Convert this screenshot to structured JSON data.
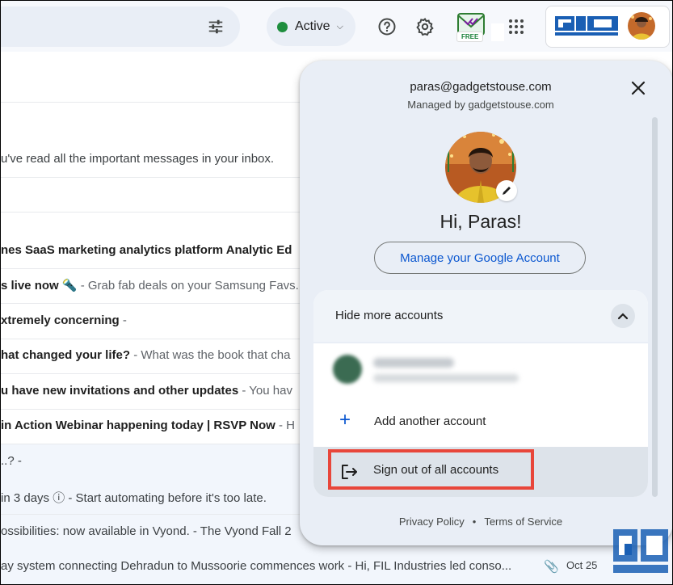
{
  "status": {
    "label": "Active"
  },
  "extension": {
    "badge": "FREE"
  },
  "emails": [
    {
      "subject": "",
      "snippet": "",
      "plain": "u've read all the important messages in your inbox.",
      "date": ""
    },
    {
      "subject": "nes SaaS marketing analytics platform Analytic Ed",
      "snippet": "",
      "plain": "",
      "date": ""
    },
    {
      "subject": "s live now 🔦",
      "snippet": " - Grab fab deals on your Samsung Favs.",
      "plain": "",
      "date": ""
    },
    {
      "subject": "xtremely concerning",
      "snippet": " -",
      "plain": "",
      "date": ""
    },
    {
      "subject": "hat changed your life?",
      "snippet": " - What was the book that cha",
      "plain": "",
      "date": ""
    },
    {
      "subject": "u have new invitations and other updates",
      "snippet": " - You hav",
      "plain": "",
      "date": ""
    },
    {
      "subject": "in Action Webinar happening today | RSVP Now",
      "snippet": " - H",
      "plain": "",
      "date": ""
    },
    {
      "subject": "",
      "snippet": "",
      "plain": "..? -",
      "date": ""
    },
    {
      "subject": "",
      "snippet": "",
      "plain": "in 3 days ⓘ - Start automating before it's too late.",
      "date": ""
    },
    {
      "subject": "",
      "snippet": "",
      "plain": "ossibilities: now available in Vyond. - The Vyond Fall 2",
      "date": ""
    },
    {
      "subject": "",
      "snippet": "",
      "plain": "ay system connecting Dehradun to Mussoorie commences work - Hi, FIL Industries led conso...",
      "date": "Oct 25"
    }
  ],
  "account_menu": {
    "email": "paras@gadgetstouse.com",
    "managed_by": "Managed by gadgetstouse.com",
    "greeting": "Hi, Paras!",
    "manage_button": "Manage your Google Account",
    "hide_accounts": "Hide more accounts",
    "add_account": "Add another account",
    "sign_out": "Sign out of all accounts",
    "privacy": "Privacy Policy",
    "terms": "Terms of Service",
    "separator": "•"
  },
  "colors": {
    "accent_blue": "#0b57d0",
    "status_green": "#1e8e3e",
    "highlight_red": "#e8463a",
    "popup_bg": "#e9eef6"
  },
  "icons": [
    "filter-icon",
    "help-icon",
    "settings-icon",
    "apps-grid-icon",
    "close-icon",
    "edit-pencil-icon",
    "chevron-up-icon",
    "plus-icon",
    "logout-icon",
    "attachment-icon"
  ]
}
